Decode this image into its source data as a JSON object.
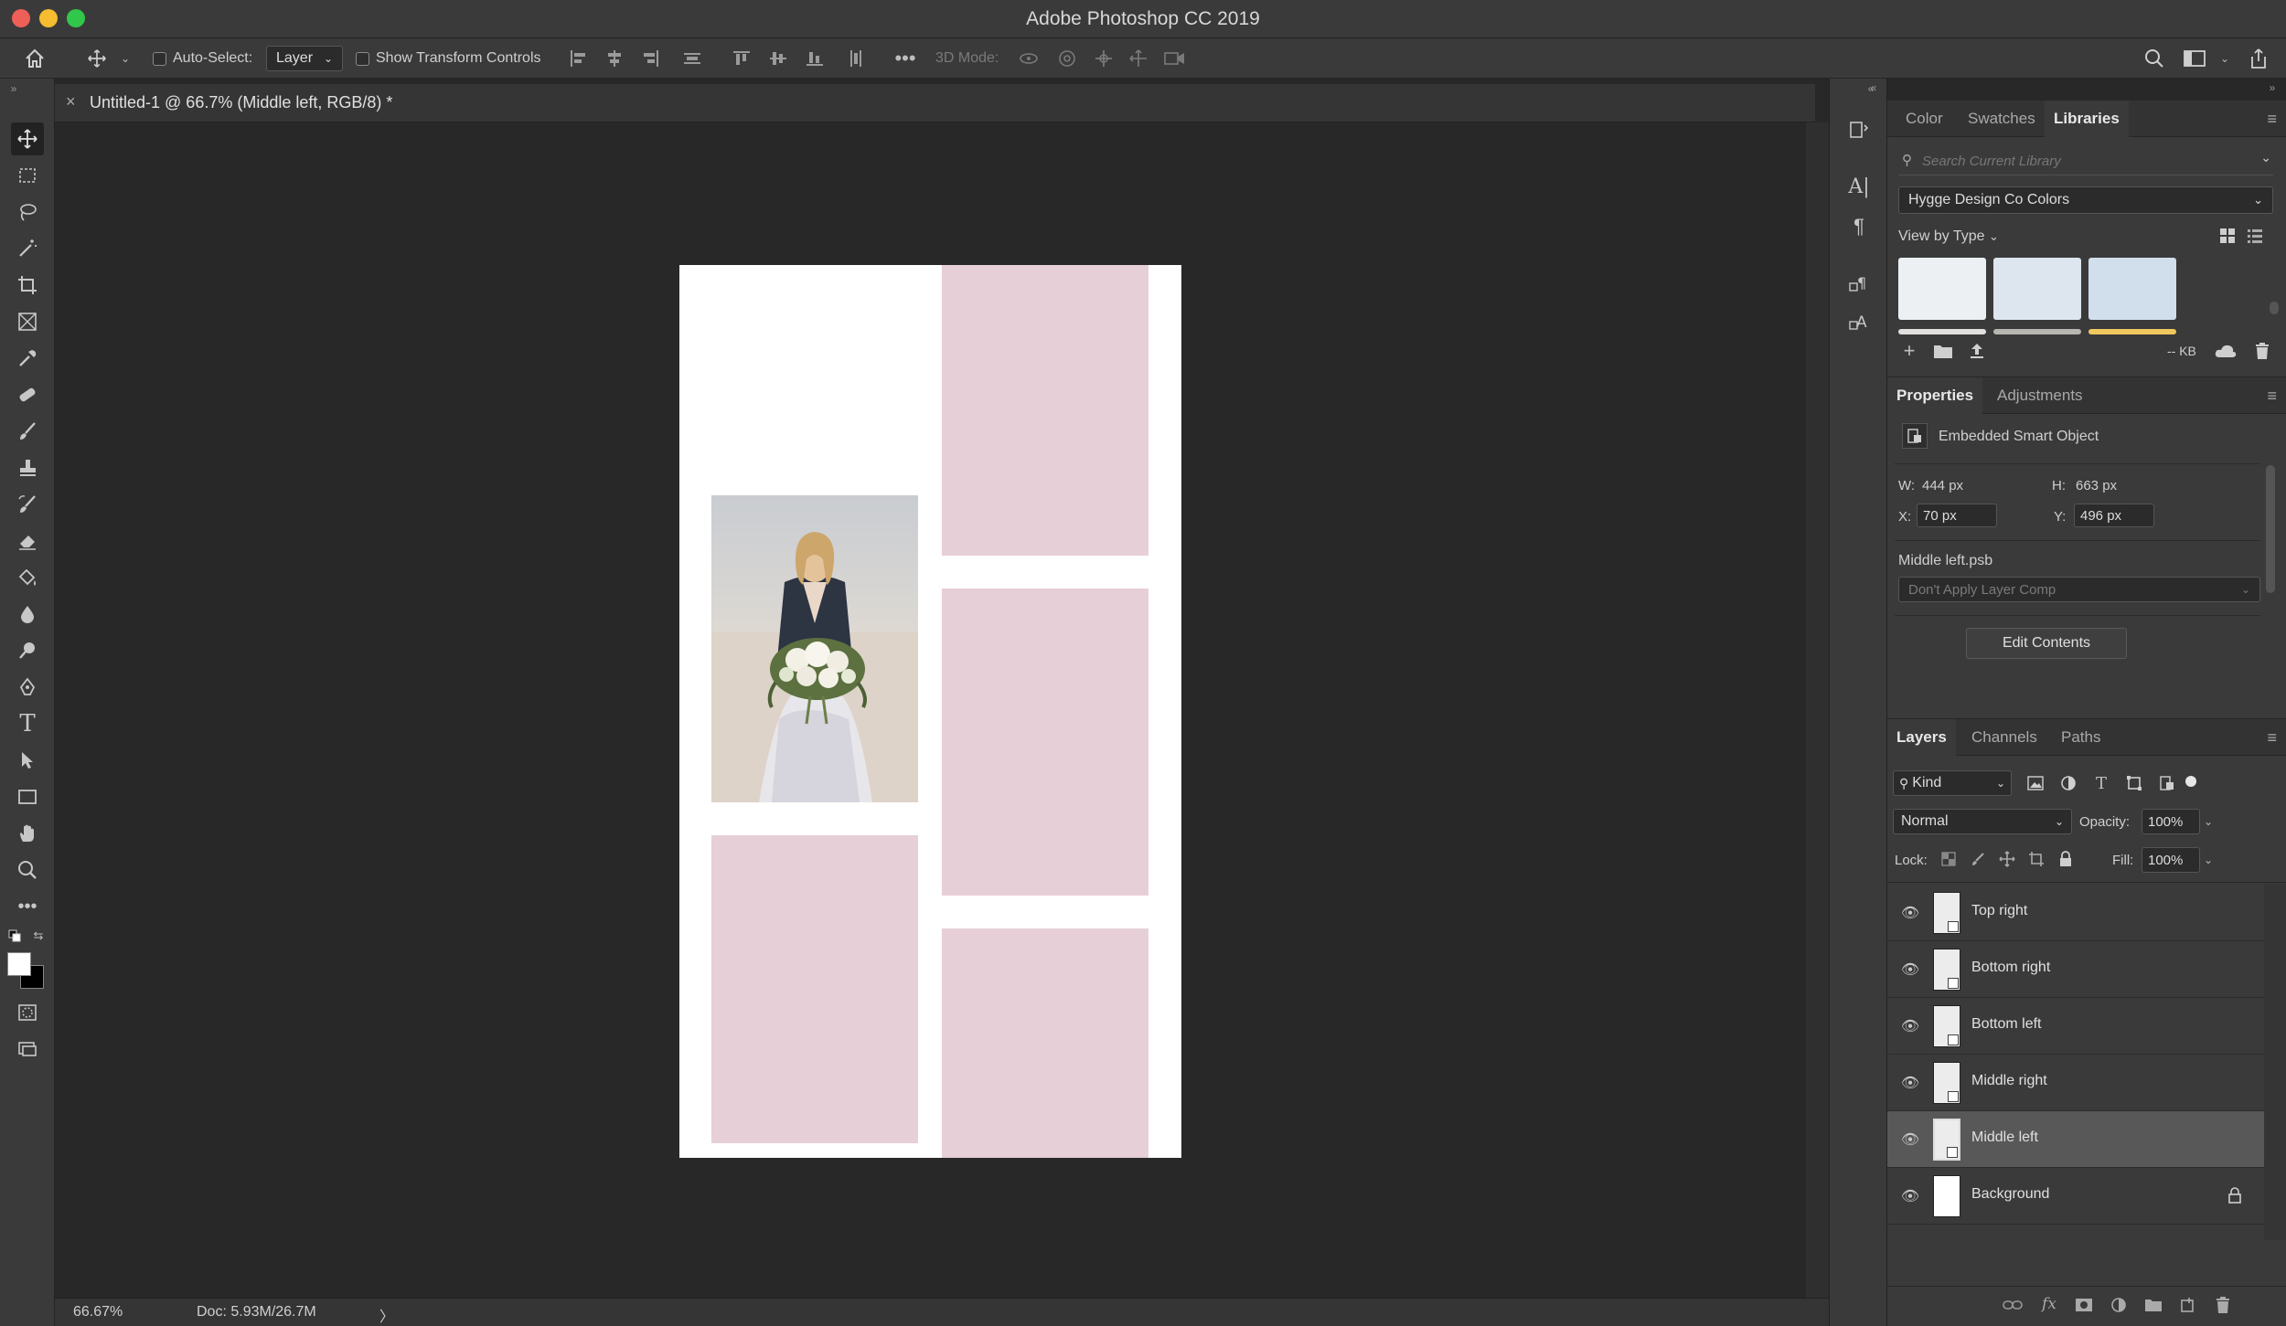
{
  "app_title": "Adobe Photoshop CC 2019",
  "options_bar": {
    "auto_select_label": "Auto-Select:",
    "auto_select_value": "Layer",
    "show_transform_label": "Show Transform Controls",
    "mode_3d_label": "3D Mode:"
  },
  "document": {
    "tab_title": "Untitled-1 @ 66.7% (Middle left, RGB/8) *",
    "canvas_color": "#ffffff",
    "frame_color": "#e7cfd7"
  },
  "status_bar": {
    "zoom": "66.67%",
    "doc_info": "Doc: 5.93M/26.7M",
    "arrow": "〉"
  },
  "libraries_panel": {
    "tabs": [
      "Color",
      "Swatches",
      "Libraries"
    ],
    "active_tab": "Libraries",
    "search_placeholder": "Search Current Library",
    "library_name": "Hygge Design Co Colors",
    "view_by": "View by Type",
    "swatch_colors": [
      "#edf0f3",
      "#dde5ee",
      "#d1dfec"
    ],
    "size_label": "-- KB"
  },
  "properties_panel": {
    "tabs": [
      "Properties",
      "Adjustments"
    ],
    "active_tab": "Properties",
    "object_type": "Embedded Smart Object",
    "w_label": "W:",
    "w_value": "444 px",
    "h_label": "H:",
    "h_value": "663 px",
    "x_label": "X:",
    "x_value": "70 px",
    "y_label": "Y:",
    "y_value": "496 px",
    "file_name": "Middle left.psb",
    "layer_comp": "Don't Apply Layer Comp",
    "edit_button": "Edit Contents"
  },
  "layers_panel": {
    "tabs": [
      "Layers",
      "Channels",
      "Paths"
    ],
    "active_tab": "Layers",
    "filter_kind": "Kind",
    "blend_mode": "Normal",
    "opacity_label": "Opacity:",
    "opacity_value": "100%",
    "lock_label": "Lock:",
    "fill_label": "Fill:",
    "fill_value": "100%",
    "layers": [
      {
        "name": "Top right",
        "selected": false,
        "smart": true
      },
      {
        "name": "Bottom right",
        "selected": false,
        "smart": true
      },
      {
        "name": "Bottom left",
        "selected": false,
        "smart": true
      },
      {
        "name": "Middle right",
        "selected": false,
        "smart": true
      },
      {
        "name": "Middle left",
        "selected": true,
        "smart": true
      },
      {
        "name": "Background",
        "selected": false,
        "smart": false,
        "locked": true
      }
    ]
  }
}
